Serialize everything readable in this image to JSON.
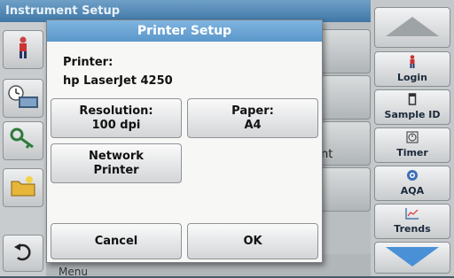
{
  "app": {
    "title": "Instrument Setup"
  },
  "background": {
    "partial_text": "nt",
    "bottom_text": "Menu"
  },
  "sidebar": {
    "login": {
      "label": "Login",
      "icon": "person-icon"
    },
    "sample_id": {
      "label": "Sample ID",
      "icon": "vial-icon"
    },
    "timer": {
      "label": "Timer",
      "icon": "timer-icon"
    },
    "aqa": {
      "label": "AQA",
      "icon": "aqa-icon"
    },
    "trends": {
      "label": "Trends",
      "icon": "trends-icon"
    }
  },
  "dialog": {
    "title": "Printer Setup",
    "printer_label": "Printer:",
    "printer_value": "hp LaserJet 4250",
    "resolution": {
      "label": "Resolution:",
      "value": "100 dpi"
    },
    "paper": {
      "label": "Paper:",
      "value": "A4"
    },
    "network": {
      "line1": "Network",
      "line2": "Printer"
    },
    "cancel_label": "Cancel",
    "ok_label": "OK"
  },
  "colors": {
    "header_blue": "#5b97cb",
    "title_blue": "#3f77a6",
    "arrow_blue": "#4a90d6"
  }
}
